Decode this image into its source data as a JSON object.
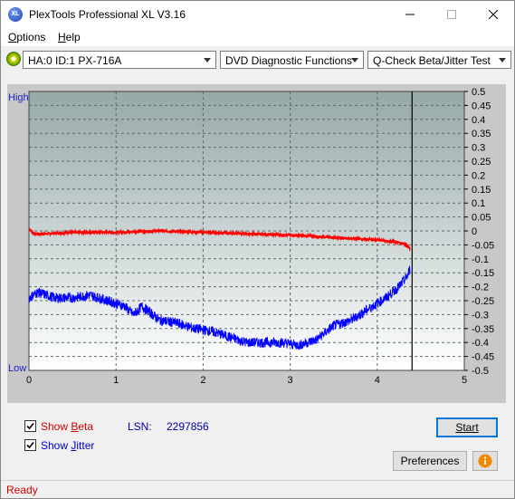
{
  "window": {
    "title": "PlexTools Professional XL V3.16",
    "app_icon_text": "XL"
  },
  "menu": [
    {
      "label": "Options",
      "accel": "O",
      "rest": "ptions"
    },
    {
      "label": "Help",
      "accel": "H",
      "rest": "elp"
    }
  ],
  "toolbar": {
    "drive": "HA:0 ID:1  PX-716A",
    "function": "DVD Diagnostic Functions",
    "test": "Q-Check Beta/Jitter Test"
  },
  "chart_data": {
    "type": "line",
    "title": "",
    "xlabel": "",
    "ylabel": "",
    "left_labels": {
      "top": "High",
      "bottom": "Low"
    },
    "xlim": [
      0,
      5
    ],
    "ylim": [
      -0.5,
      0.5
    ],
    "x_ticks": [
      "0",
      "1",
      "2",
      "3",
      "4",
      "5"
    ],
    "y_ticks": [
      "0.5",
      "0.45",
      "0.4",
      "0.35",
      "0.3",
      "0.25",
      "0.2",
      "0.15",
      "0.1",
      "0.05",
      "0",
      "-0.05",
      "-0.1",
      "-0.15",
      "-0.2",
      "-0.25",
      "-0.3",
      "-0.35",
      "-0.4",
      "-0.45",
      "-0.5"
    ],
    "grid": true,
    "cursor_x": 4.4,
    "series": [
      {
        "name": "Beta",
        "color": "#ff0000",
        "x": [
          0,
          0.05,
          0.2,
          0.5,
          1.0,
          1.5,
          2.0,
          2.5,
          3.0,
          3.3,
          3.6,
          3.9,
          4.1,
          4.2,
          4.3,
          4.35,
          4.38
        ],
        "y": [
          0.01,
          -0.01,
          -0.01,
          -0.005,
          -0.005,
          0.0,
          -0.005,
          -0.01,
          -0.015,
          -0.02,
          -0.025,
          -0.03,
          -0.035,
          -0.04,
          -0.045,
          -0.055,
          -0.065
        ]
      },
      {
        "name": "Jitter",
        "color": "#0000ff",
        "x": [
          0,
          0.1,
          0.3,
          0.5,
          0.7,
          0.9,
          1.1,
          1.2,
          1.3,
          1.5,
          1.7,
          1.9,
          2.1,
          2.3,
          2.5,
          2.7,
          2.9,
          3.1,
          3.3,
          3.5,
          3.7,
          3.9,
          4.1,
          4.25,
          4.35,
          4.38
        ],
        "y": [
          -0.24,
          -0.22,
          -0.24,
          -0.24,
          -0.23,
          -0.25,
          -0.27,
          -0.3,
          -0.27,
          -0.32,
          -0.33,
          -0.35,
          -0.36,
          -0.38,
          -0.4,
          -0.4,
          -0.4,
          -0.41,
          -0.39,
          -0.34,
          -0.32,
          -0.28,
          -0.24,
          -0.2,
          -0.16,
          -0.13
        ]
      }
    ]
  },
  "controls": {
    "show_beta": {
      "label": "Show Beta",
      "accel": "B",
      "pre": "Show ",
      "rest": "eta",
      "checked": true,
      "color": "#d00000"
    },
    "show_jitter": {
      "label": "Show Jitter",
      "accel": "J",
      "pre": "Show ",
      "rest": "itter",
      "checked": true,
      "color": "#0000cc"
    },
    "lsn_label": "LSN:",
    "lsn_value": "2297856",
    "start_button": "Start",
    "preferences_button": "Preferences",
    "info_icon": "info-icon"
  },
  "status": {
    "text": "Ready"
  }
}
